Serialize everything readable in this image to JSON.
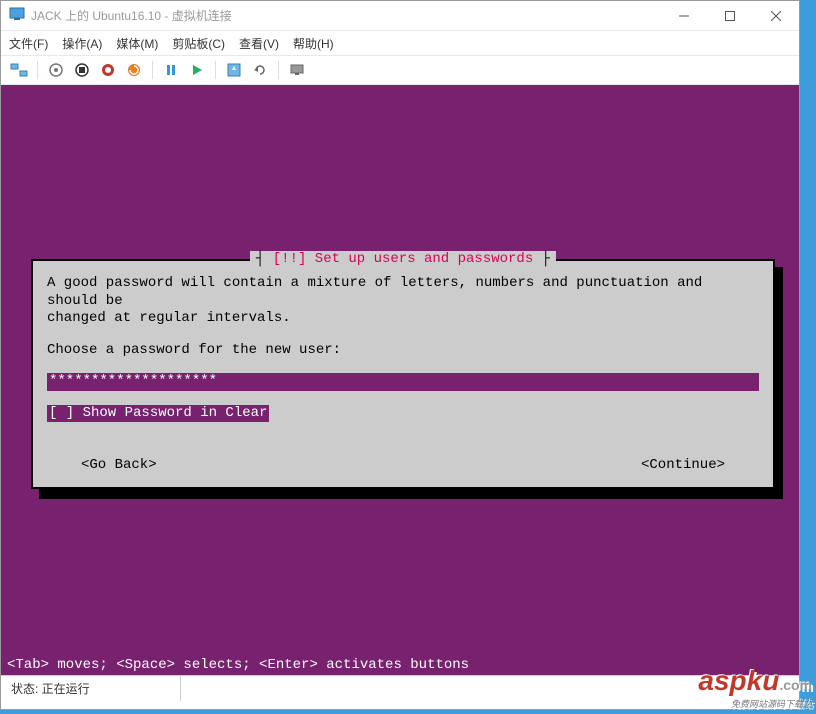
{
  "window": {
    "title": "JACK 上的 Ubuntu16.10 - 虚拟机连接"
  },
  "menu": {
    "file": "文件(F)",
    "action": "操作(A)",
    "media": "媒体(M)",
    "clipboard": "剪贴板(C)",
    "view": "查看(V)",
    "help": "帮助(H)"
  },
  "dialog": {
    "title_left_bracket": "[!!] ",
    "title_text": "Set up users and passwords",
    "body_line1": "A good password will contain a mixture of letters, numbers and punctuation and should be",
    "body_line2": "changed at regular intervals.",
    "prompt": "Choose a password for the new user:",
    "password_mask": "********************",
    "show_pw": "[ ] Show Password in Clear",
    "go_back": "<Go Back>",
    "continue": "<Continue>"
  },
  "hint": "<Tab> moves; <Space> selects; <Enter> activates buttons",
  "status": {
    "label": "状态: 正在运行"
  },
  "watermark": {
    "main": "aspku",
    "dot": ".com",
    "sub": "免费网站源码下载站"
  }
}
